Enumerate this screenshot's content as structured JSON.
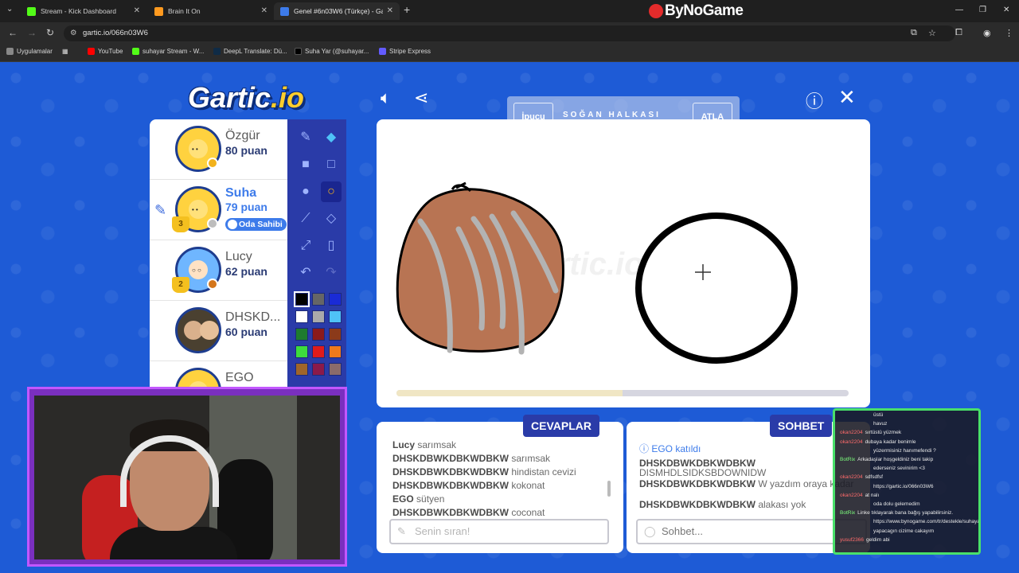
{
  "browser": {
    "tabs": [
      {
        "title": "Stream - Kick Dashboard",
        "favicon_color": "#53fc18"
      },
      {
        "title": "Brain It On",
        "favicon_color": "#ff9a1f"
      },
      {
        "title": "Genel #6n03W6 (Türkçe) - Gart",
        "favicon_color": "#3d7bea"
      }
    ],
    "new_tab": "+",
    "brand": "ByNoGame",
    "url": "gartic.io/066n03W6",
    "bookmarks": [
      {
        "label": "Uygulamalar",
        "color": "#888888"
      },
      {
        "label": "YouTube",
        "color": "#ff0000"
      },
      {
        "label": "suhayar Stream - W...",
        "color": "#53fc18"
      },
      {
        "label": "DeepL Translate: Dü...",
        "color": "#0f2b46"
      },
      {
        "label": "Suha Yar (@suhayar...",
        "color": "#000000"
      },
      {
        "label": "Stripe Express",
        "color": "#635bff"
      }
    ]
  },
  "game": {
    "logo_main": "Gartic",
    "logo_suffix": ".io",
    "hint_button": "İpucu",
    "hint_word": "SOĞAN HALKASI",
    "skip_button": "ATLA",
    "players": [
      {
        "name": "Özgür",
        "points": "80 puan",
        "status_color": "#f2b21c"
      },
      {
        "name": "Suha",
        "points": "79 puan",
        "status_color": "#bdbdbd",
        "badge": "Oda Sahibi",
        "rank": "3"
      },
      {
        "name": "Lucy",
        "points": "62 puan",
        "status_color": "#d4761c",
        "rank": "2"
      },
      {
        "name": "DHSKD...",
        "points": "60 puan"
      },
      {
        "name": "EGO",
        "points": ""
      }
    ],
    "palette": [
      "#000000",
      "#666666",
      "#1a2bd6",
      "#ffffff",
      "#aaaaaa",
      "#4fc3f7",
      "#1e7b2e",
      "#8b1a1a",
      "#8b3a1a",
      "#3ddc3d",
      "#e01b1b",
      "#f07a1c",
      "#a0652a",
      "#8b1a4a",
      "#8b6b6b"
    ],
    "timer_progress": 0.5,
    "watermark": "gartic.io",
    "answers_tab": "CEVAPLAR",
    "chat_tab": "SOHBET",
    "answers": [
      {
        "who": "Lucy",
        "text": "sarımsak"
      },
      {
        "who": "DHSKDBWKDBKWDBKW",
        "text": "sarımsak"
      },
      {
        "who": "DHSKDBWKDBKWDBKW",
        "text": "hindistan cevizi"
      },
      {
        "who": "DHSKDBWKDBKWDBKW",
        "text": "kokonat"
      },
      {
        "who": "EGO",
        "text": "sütyen"
      },
      {
        "who": "DHSKDBWKDBKWDBKW",
        "text": "coconat"
      }
    ],
    "answer_placeholder": "Senin sıran!",
    "chat": [
      {
        "who": "EGO",
        "text": "katıldı",
        "system": true
      },
      {
        "who": "DHSKDBWKDBKWDBKW",
        "text": "DISMHDLSIDKSBDOWNIDW"
      },
      {
        "who": "DHSKDBWKDBKWDBKW",
        "text": "W yazdım oraya kadar"
      },
      {
        "who": "DHSKDBWKDBKWDBKW",
        "text": "alakası yok"
      }
    ],
    "chat_placeholder": "Sohbet..."
  },
  "stream_chat": [
    {
      "user": "",
      "text": "üstü"
    },
    {
      "user": "",
      "text": "havuz"
    },
    {
      "user": "okan2204",
      "text": "sırtüstü yüzmek"
    },
    {
      "user": "okan2204",
      "text": "dubaya kadar benimle"
    },
    {
      "user": "",
      "text": "yüzermisiniz hanımefendi ?"
    },
    {
      "user": "BotRix",
      "text": "Arkadaşlar hoşgeldiniz beni takip",
      "bot": true
    },
    {
      "user": "",
      "text": "ederseniz sevinirim <3"
    },
    {
      "user": "okan2204",
      "text": "sdfsdfsf"
    },
    {
      "user": "",
      "text": "https://gartic.io/066n03W6"
    },
    {
      "user": "okan2204",
      "text": "at nalı"
    },
    {
      "user": "",
      "text": "oda dolu gelemedim"
    },
    {
      "user": "BotRix",
      "text": "Linke tıklayarak bana bağış yapabilirsiniz.",
      "bot": true
    },
    {
      "user": "",
      "text": "https://www.bynogame.com/tr/destekle/suhayar"
    },
    {
      "user": "",
      "text": "yapacagın cizime cakayım"
    },
    {
      "user": "yusuf2366",
      "text": "geldim abi"
    }
  ]
}
